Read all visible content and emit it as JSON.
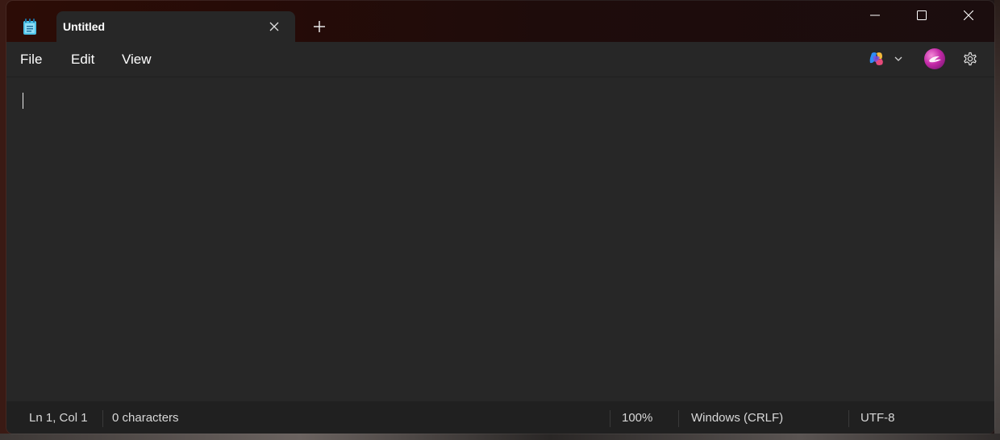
{
  "window": {
    "tab_title": "Untitled"
  },
  "menu": {
    "file": "File",
    "edit": "Edit",
    "view": "View"
  },
  "status": {
    "position": "Ln 1, Col 1",
    "characters": "0 characters",
    "zoom": "100%",
    "line_ending": "Windows (CRLF)",
    "encoding": "UTF-8"
  },
  "icons": {
    "app": "notepad-icon",
    "tab_close": "close-icon",
    "new_tab": "plus-icon",
    "minimize": "minimize-icon",
    "maximize": "maximize-icon",
    "close": "close-icon",
    "copilot": "copilot-icon",
    "chevron": "chevron-down-icon",
    "avatar": "avatar",
    "settings": "gear-icon"
  },
  "colors": {
    "editor_bg": "#272727",
    "statusbar_bg": "#202020",
    "titlebar_bg": "#260b07",
    "text": "#ffffff"
  }
}
